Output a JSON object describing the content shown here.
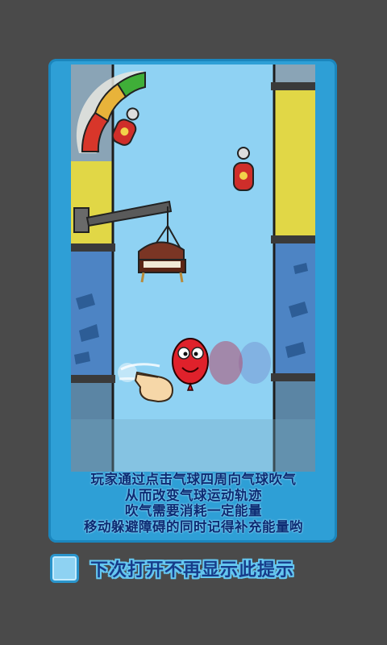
{
  "tutorial": {
    "caption_lines": [
      "玩家通过点击气球四周向气球吹气",
      "从而改变气球运动轨迹",
      "吹气需要消耗一定能量",
      "移动躲避障碍的同时记得补充能量哟"
    ]
  },
  "footer": {
    "dont_show_label": "下次打开不再显示此提示",
    "checkbox_checked": false
  },
  "colors": {
    "background": "#4a4a4a",
    "panel_blue": "#2e9fd6",
    "sky": "#7ec9ef",
    "caption_text": "#0d2b73",
    "balloon_red": "#e0212b"
  },
  "icons": [
    "energy-gauge-icon",
    "gas-canister-icon",
    "crane-icon",
    "piano-icon",
    "balloon-icon",
    "pointing-hand-icon"
  ]
}
